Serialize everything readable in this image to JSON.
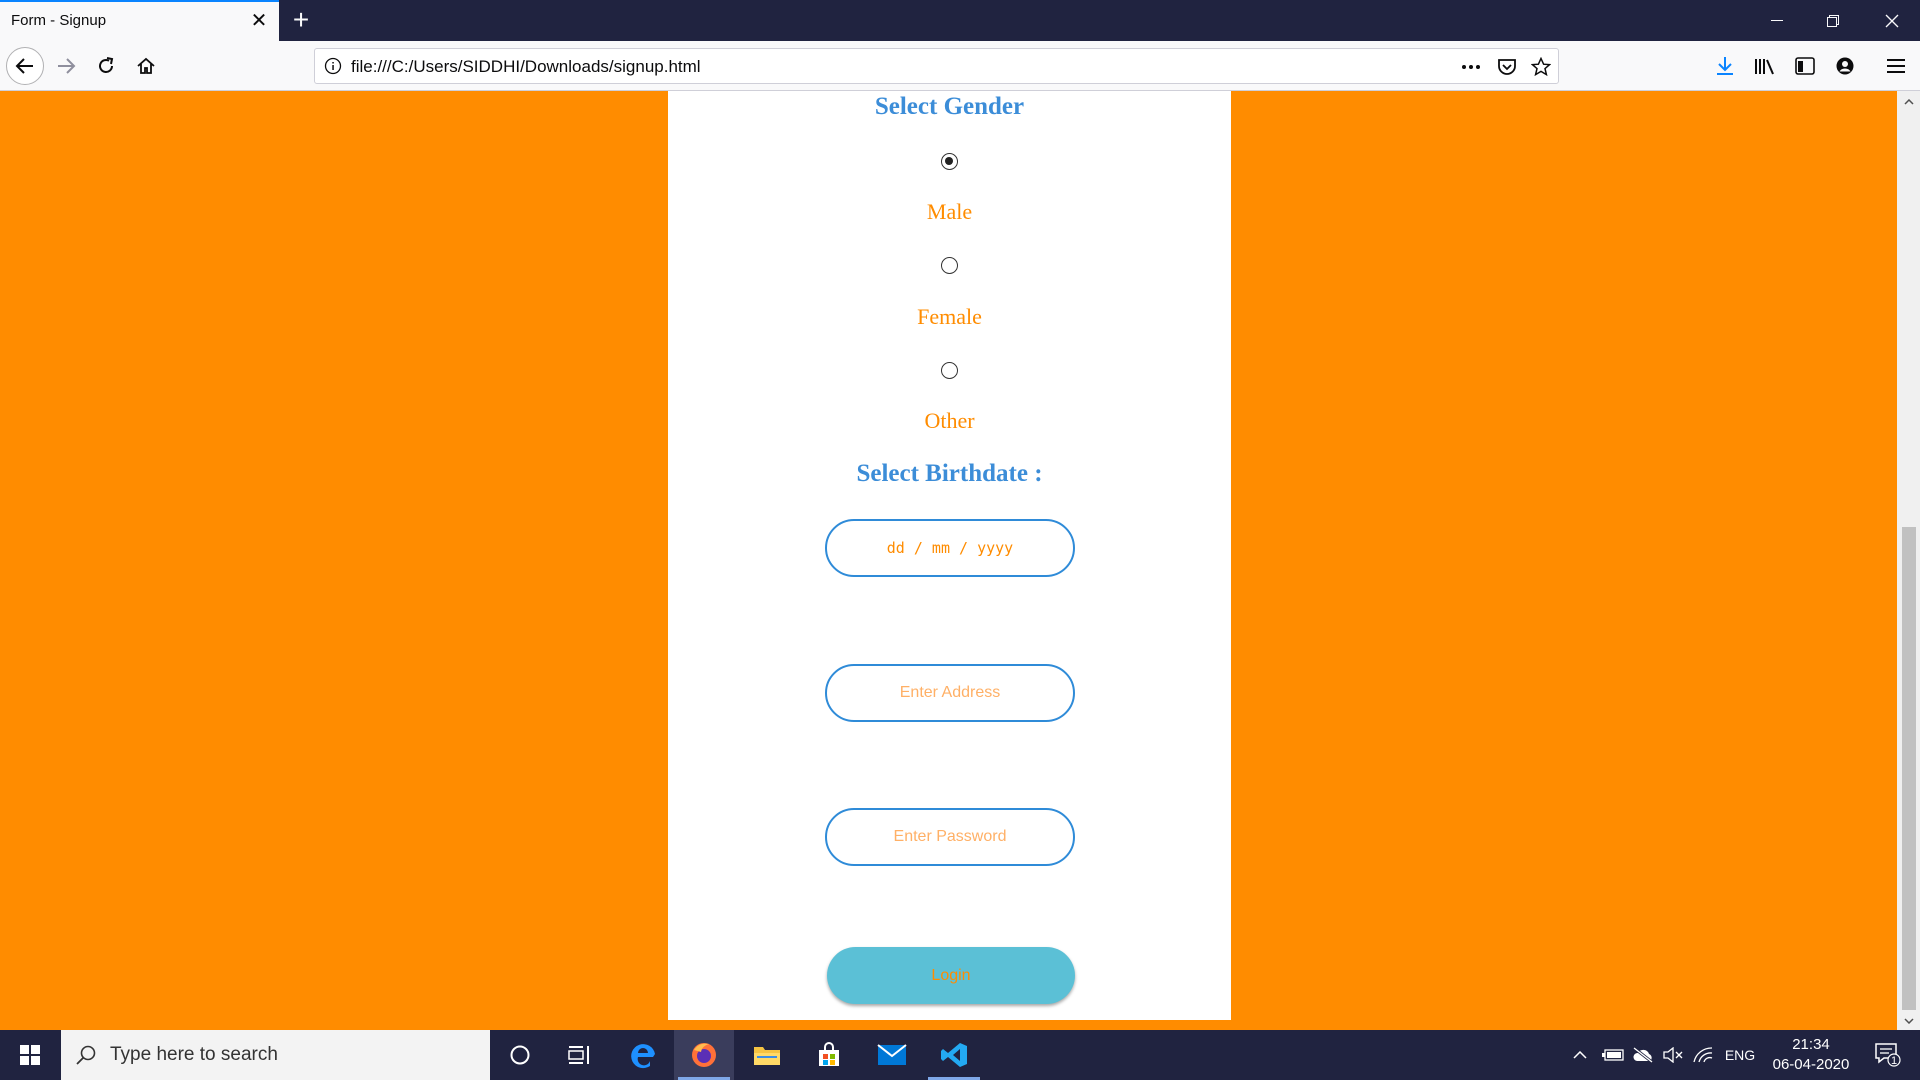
{
  "browser": {
    "tab_title": "Form - Signup",
    "url": "file:///C:/Users/SIDDHI/Downloads/signup.html"
  },
  "form": {
    "gender_heading": "Select Gender",
    "gender_options": [
      {
        "label": "Male",
        "checked": true
      },
      {
        "label": "Female",
        "checked": false
      },
      {
        "label": "Other",
        "checked": false
      }
    ],
    "birthdate_heading": "Select Birthdate :",
    "date_placeholder": "dd / mm / yyyy",
    "address_placeholder": "Enter Address",
    "password_placeholder": "Enter Password",
    "login_label": "Login"
  },
  "taskbar": {
    "search_placeholder": "Type here to search",
    "language": "ENG",
    "time": "21:34",
    "date": "06-04-2020",
    "notification_count": "1"
  },
  "colors": {
    "page_background": "#ff8c00",
    "heading_blue": "#3c8dd8",
    "label_orange": "#ff8c00",
    "field_border": "#2f8bd8",
    "login_button": "#5bc0d6"
  }
}
